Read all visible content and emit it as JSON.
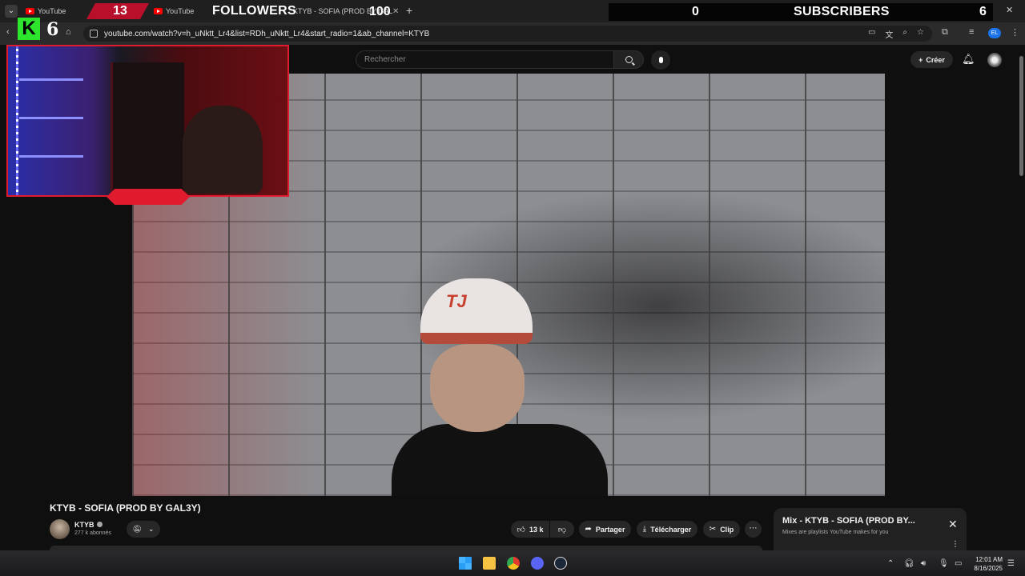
{
  "browser": {
    "tabs": [
      {
        "label": "YouTube"
      },
      {
        "label": "YouTube"
      },
      {
        "label": "KTYB - SOFIA (PROD BY GAL3Y)"
      }
    ],
    "new_tab_label": "+",
    "url": "youtube.com/watch?v=h_uNktt_Lr4&list=RDh_uNktt_Lr4&start_radio=1&ab_channel=KTYB",
    "profile_initials": "EL"
  },
  "overlay": {
    "red_count": "13",
    "followers_label": "FOLLOWERS",
    "followers_goal": "100",
    "subs_current": "0",
    "subscribers_label": "SUBSCRIBERS",
    "subs_goal": "6",
    "kick_letter": "K",
    "kick_number": "6"
  },
  "youtube": {
    "search_placeholder": "Rechercher",
    "create_label": "Créer"
  },
  "video": {
    "cap_text": "TJ",
    "title": "KTYB - SOFIA (PROD BY GAL3Y)",
    "channel_name": "KTYB",
    "subscribers": "277 k abonnés",
    "likes": "13 k",
    "share_label": "Partager",
    "download_label": "Télécharger",
    "clip_label": "Clip"
  },
  "mix": {
    "title": "Mix - KTYB - SOFIA (PROD BY...",
    "subtitle": "Mixes are playlists YouTube makes for you"
  },
  "taskbar": {
    "time": "12:01 AM",
    "date": "8/16/2025"
  }
}
